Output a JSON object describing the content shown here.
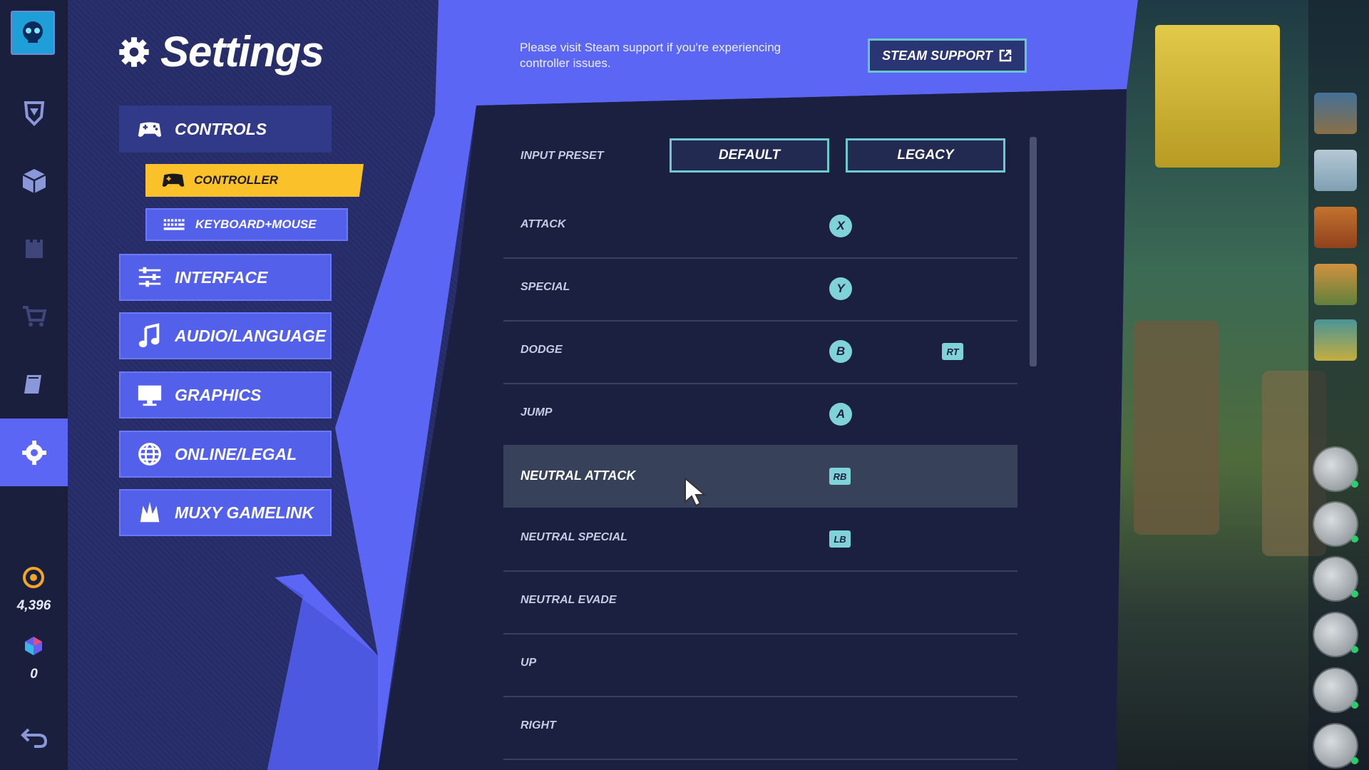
{
  "rail": {
    "currency_gold": "4,396",
    "currency_gems": "0"
  },
  "settings": {
    "title": "Settings",
    "categories": [
      {
        "label": "CONTROLS"
      },
      {
        "label": "INTERFACE"
      },
      {
        "label": "AUDIO/LANGUAGE"
      },
      {
        "label": "GRAPHICS"
      },
      {
        "label": "ONLINE/LEGAL"
      },
      {
        "label": "MUXY GAMELINK"
      }
    ],
    "subcategories": [
      {
        "label": "CONTROLLER"
      },
      {
        "label": "KEYBOARD+MOUSE"
      }
    ]
  },
  "support": {
    "message": "Please visit Steam support if you're experiencing controller issues.",
    "button_label": "STEAM SUPPORT"
  },
  "preset": {
    "label": "INPUT PRESET",
    "options": [
      "DEFAULT",
      "LEGACY"
    ]
  },
  "bindings": [
    {
      "action": "ATTACK",
      "primary": "X",
      "primary_style": "circle",
      "secondary": ""
    },
    {
      "action": "SPECIAL",
      "primary": "Y",
      "primary_style": "circle",
      "secondary": ""
    },
    {
      "action": "DODGE",
      "primary": "B",
      "primary_style": "circle",
      "secondary": "RT"
    },
    {
      "action": "JUMP",
      "primary": "A",
      "primary_style": "circle",
      "secondary": ""
    },
    {
      "action": "NEUTRAL ATTACK",
      "primary": "RB",
      "primary_style": "box",
      "secondary": "",
      "highlighted": true
    },
    {
      "action": "NEUTRAL SPECIAL",
      "primary": "LB",
      "primary_style": "box",
      "secondary": ""
    },
    {
      "action": "NEUTRAL EVADE",
      "primary": "",
      "secondary": ""
    },
    {
      "action": "UP",
      "primary": "",
      "secondary": ""
    },
    {
      "action": "RIGHT",
      "primary": "",
      "secondary": ""
    }
  ],
  "colors": {
    "accent_blue": "#5b67f4",
    "accent_yellow": "#fbc12b",
    "key_teal": "#7fd3d8",
    "panel_dark": "#1b2040"
  }
}
